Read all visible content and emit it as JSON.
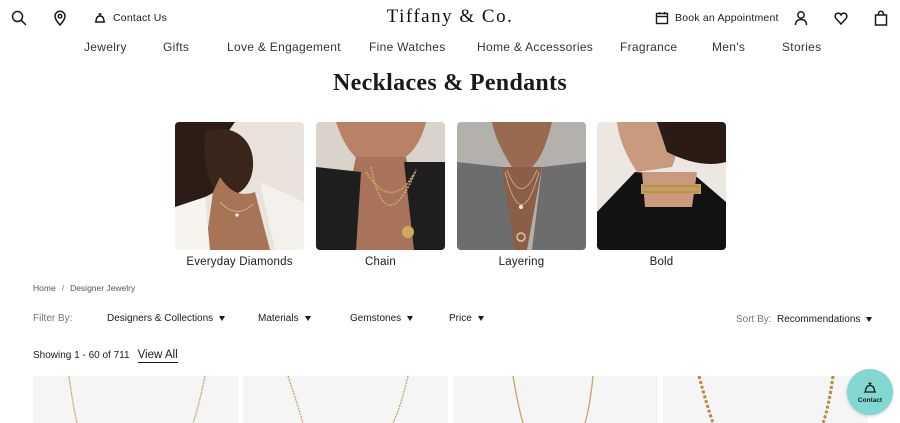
{
  "header": {
    "logo_text": "Tiffany & Co.",
    "contact_label": "Contact Us",
    "appointment_label": "Book an Appointment",
    "icons": [
      "search-icon",
      "location-pin-icon",
      "bell-icon",
      "calendar-icon",
      "account-icon",
      "heart-icon",
      "bag-icon"
    ]
  },
  "nav": {
    "items": [
      {
        "label": "Jewelry"
      },
      {
        "label": "Gifts"
      },
      {
        "label": "Love & Engagement"
      },
      {
        "label": "Fine Watches"
      },
      {
        "label": "Home & Accessories"
      },
      {
        "label": "Fragrance"
      },
      {
        "label": "Men's"
      },
      {
        "label": "Stories"
      }
    ]
  },
  "page": {
    "title": "Necklaces & Pendants"
  },
  "categories": [
    {
      "label": "Everyday Diamonds"
    },
    {
      "label": "Chain"
    },
    {
      "label": "Layering"
    },
    {
      "label": "Bold"
    }
  ],
  "breadcrumb": {
    "home": "Home",
    "separator": "/",
    "current": "Designer Jewelry"
  },
  "filters": {
    "filter_by_label": "Filter By:",
    "items": [
      {
        "label": "Designers & Collections"
      },
      {
        "label": "Materials"
      },
      {
        "label": "Gemstones"
      },
      {
        "label": "Price"
      }
    ],
    "sort_by_label": "Sort By:",
    "sort_value": "Recommendations"
  },
  "results": {
    "count_text": "Showing 1 - 60 of 711",
    "view_all_label": "View All"
  },
  "contact_fab": {
    "label": "Contact",
    "color": "#81d8d0"
  },
  "colors": {
    "tiffany_blue": "#81d8d0",
    "text": "#1a1a1a",
    "gold": "#c9a36a"
  }
}
